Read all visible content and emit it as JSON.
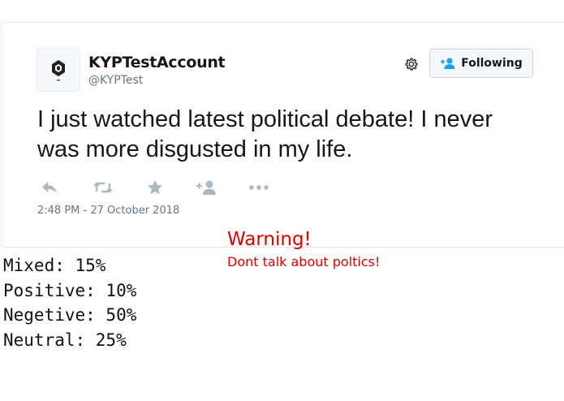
{
  "tweet": {
    "account_name": "KYPTestAccount",
    "handle": "@KYPTest",
    "follow_label": "Following",
    "text": "I just watched latest political debate! I never was more disgusted in my life.",
    "timestamp": "2:48 PM - 27 October 2018",
    "action_icons": [
      "reply-icon",
      "retweet-icon",
      "like-icon",
      "follow-person-icon",
      "more-icon"
    ]
  },
  "warning": {
    "title": "Warning!",
    "message": "Dont talk about poltics!",
    "color": "#e00000"
  },
  "sentiment": [
    {
      "label": "Mixed: 15%"
    },
    {
      "label": "Positive: 10%"
    },
    {
      "label": "Negetive: 50%"
    },
    {
      "label": "Neutral: 25%"
    }
  ],
  "colors": {
    "card_border": "#e1e8ed",
    "muted_text": "#657786",
    "accent": "#1da1f2",
    "icon_gray": "#aab8c2"
  }
}
